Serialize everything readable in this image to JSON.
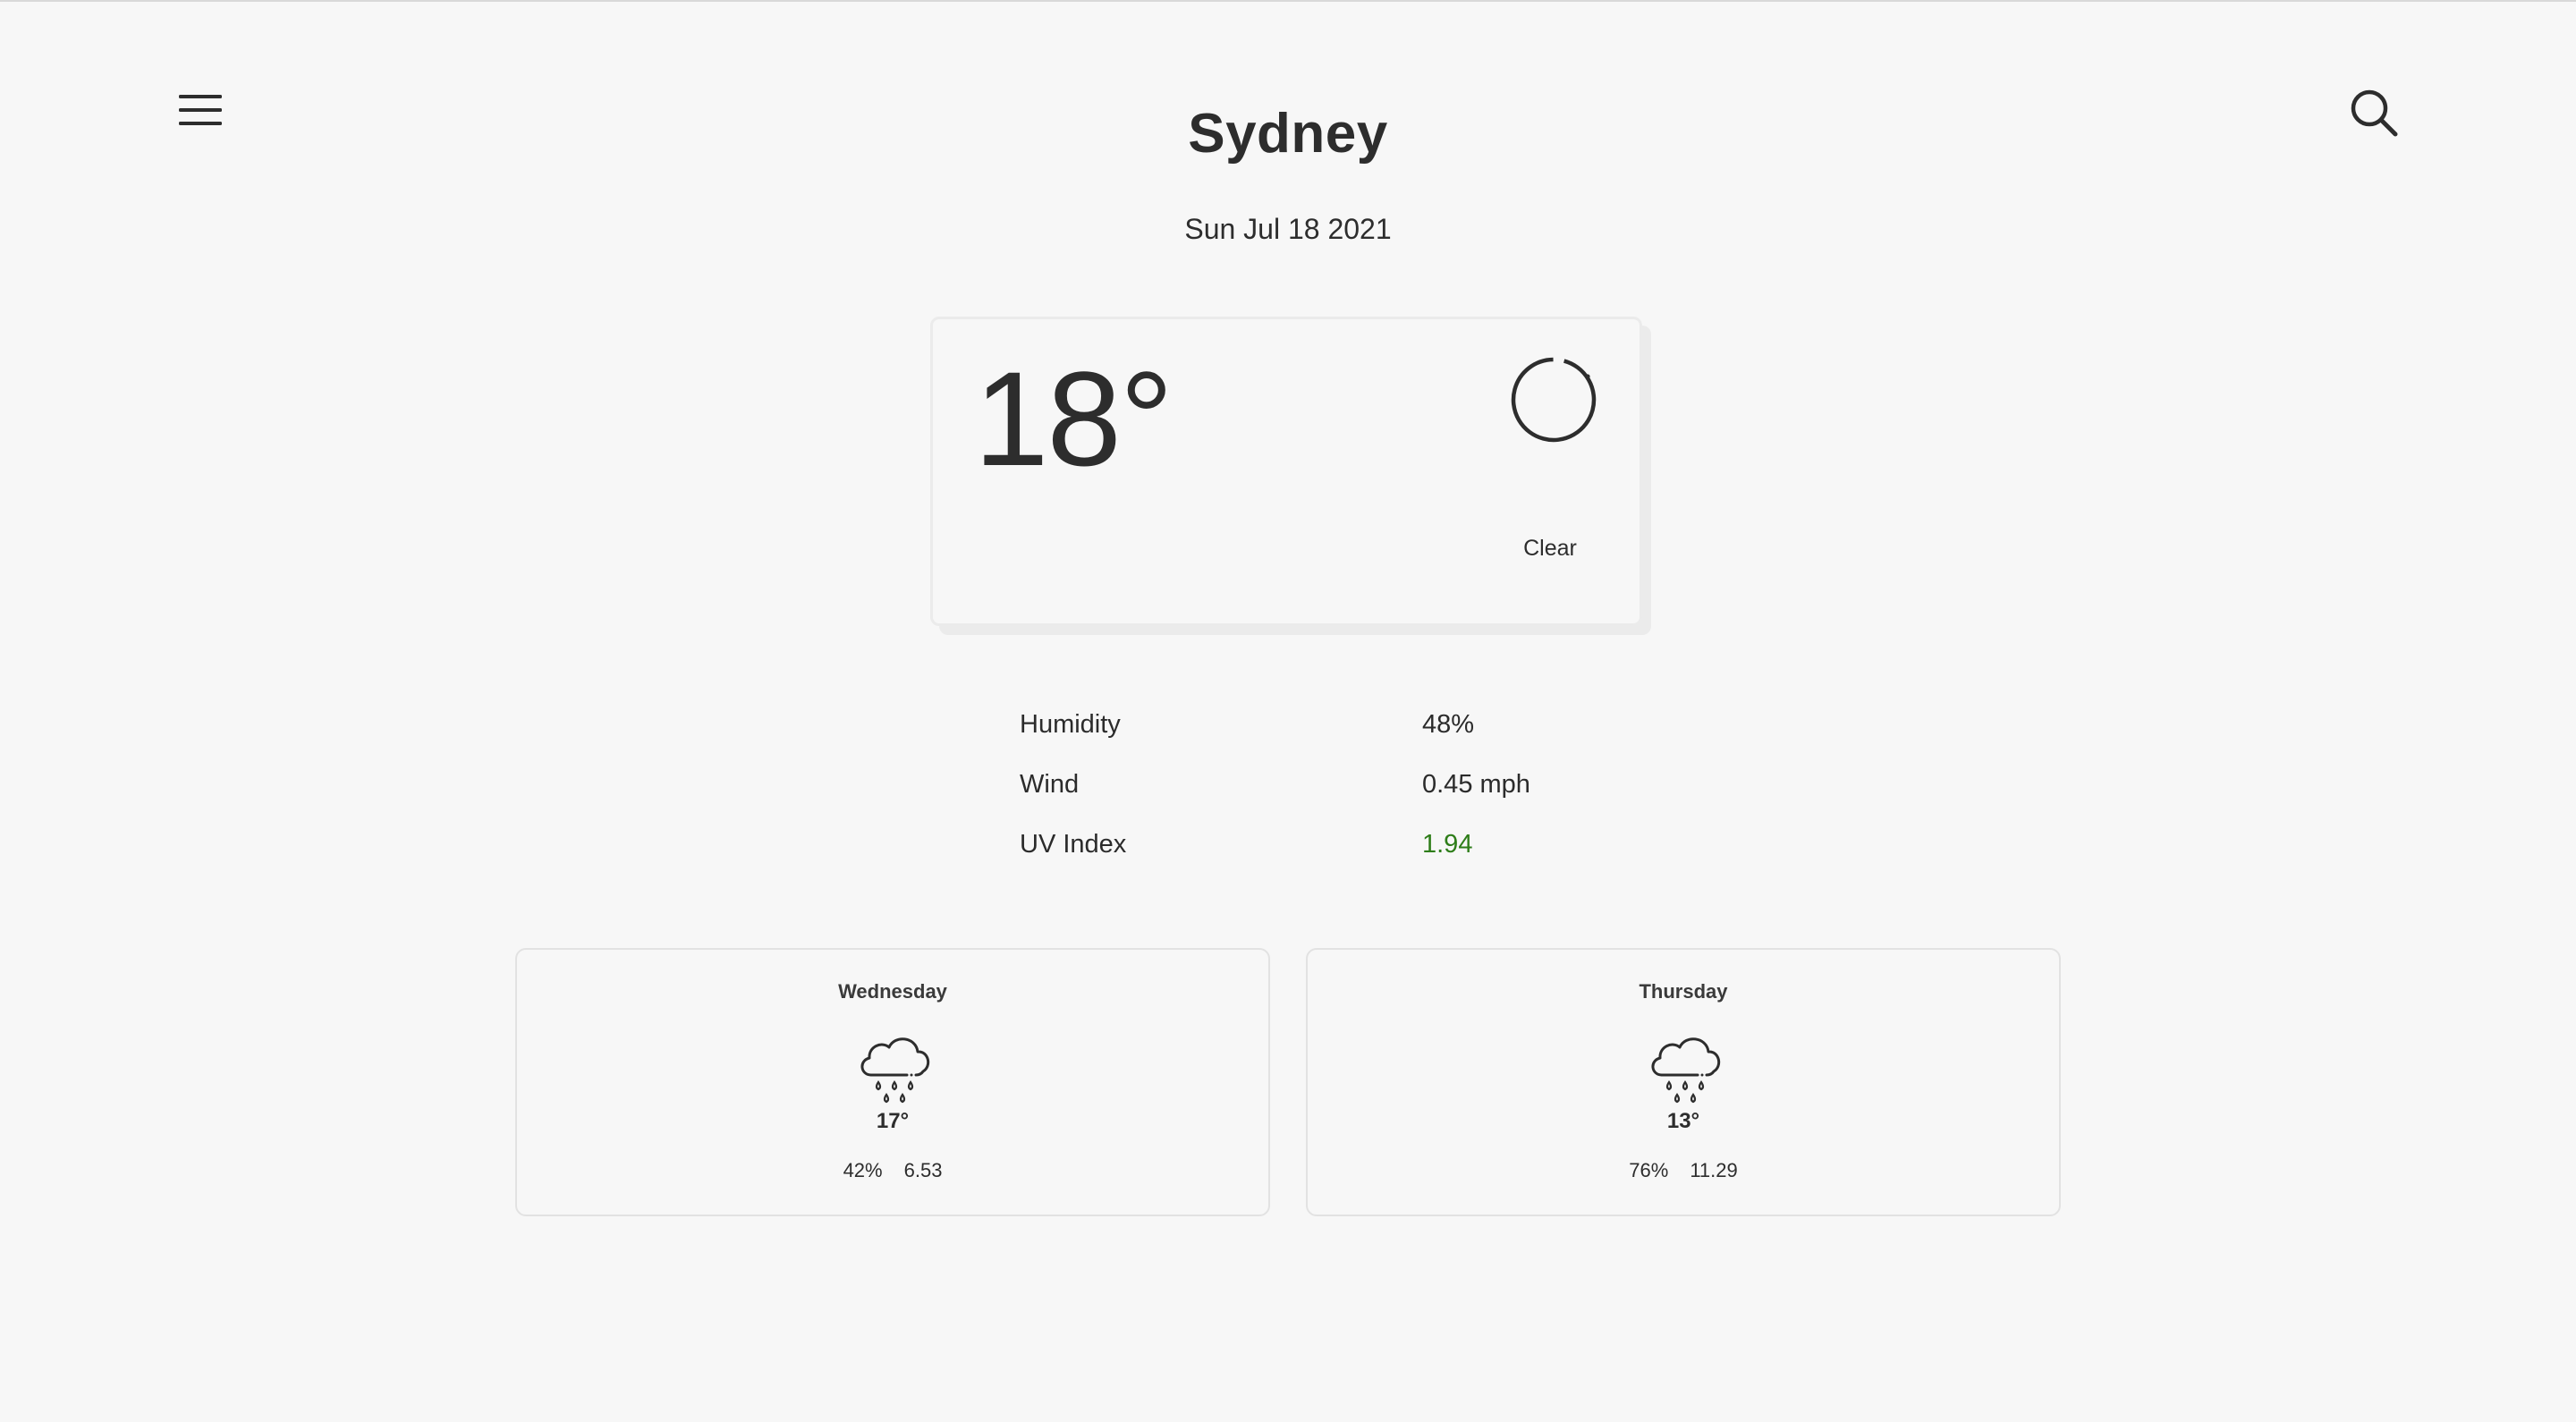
{
  "header": {
    "menu_icon": "hamburger-menu-icon",
    "search_icon": "search-icon",
    "city": "Sydney",
    "date": "Sun Jul 18 2021"
  },
  "current": {
    "temperature": "18°",
    "condition": "Clear",
    "icon": "clear-sky-circle-icon"
  },
  "details": {
    "humidity_label": "Humidity",
    "humidity_value": "48%",
    "wind_label": "Wind",
    "wind_value": "0.45 mph",
    "uv_label": "UV Index",
    "uv_value": "1.94",
    "uv_color": "#2e7d19"
  },
  "forecast": [
    {
      "day": "Wednesday",
      "icon": "rain-cloud-icon",
      "temperature": "17°",
      "humidity": "42%",
      "wind": "6.53"
    },
    {
      "day": "Thursday",
      "icon": "rain-cloud-icon",
      "temperature": "13°",
      "humidity": "76%",
      "wind": "11.29"
    }
  ],
  "colors": {
    "background": "#f7f7f7",
    "text": "#2d2d2d",
    "card_border": "#ebebeb"
  }
}
